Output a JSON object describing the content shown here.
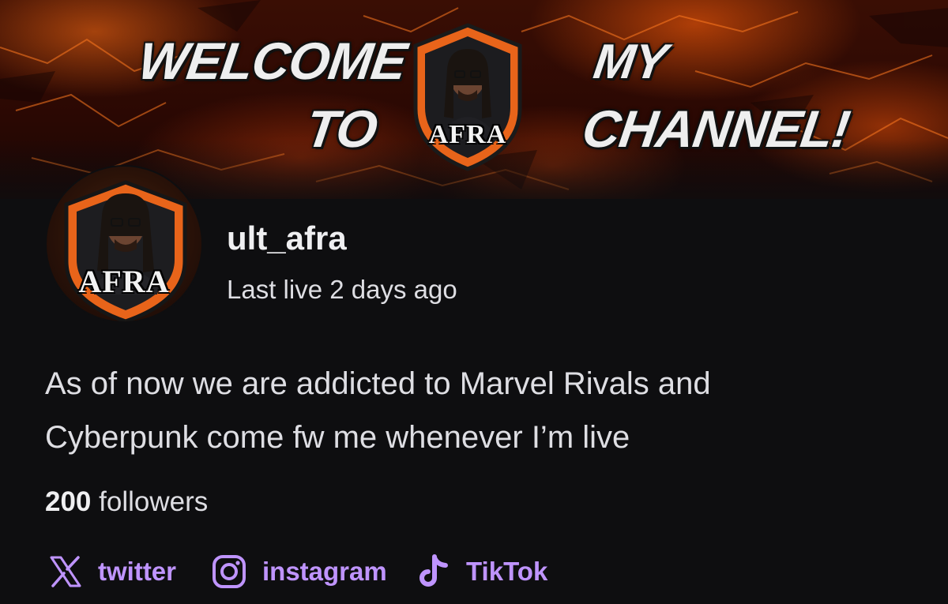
{
  "banner": {
    "words": [
      "WELCOME",
      "TO",
      "MY",
      "CHANNEL!"
    ],
    "logo_text": "AFRA"
  },
  "profile": {
    "avatar_text": "AFRA",
    "username": "ult_afra",
    "last_live": "Last live 2 days ago",
    "bio_line1": "As of now we are addicted to Marvel Rivals and",
    "bio_line2": "Cyberpunk come fw me whenever I’m live",
    "follower_count": "200",
    "follower_label": "followers"
  },
  "socials": [
    {
      "label": "twitter",
      "icon": "x-icon"
    },
    {
      "label": "instagram",
      "icon": "instagram-icon"
    },
    {
      "label": "TikTok",
      "icon": "tiktok-icon"
    }
  ],
  "colors": {
    "background": "#0e0e10",
    "text": "#efeff1",
    "link": "#bf94ff",
    "banner_orange": "#ff6a14",
    "logo_orange": "#e8641a"
  }
}
